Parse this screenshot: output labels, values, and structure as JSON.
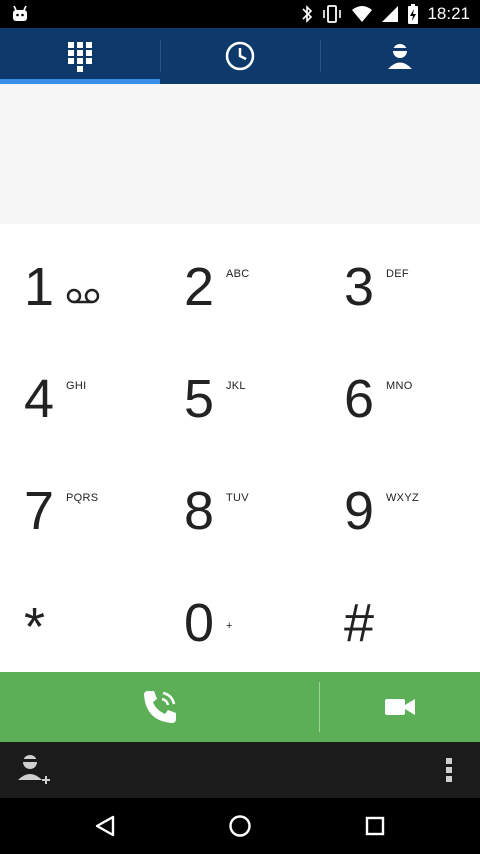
{
  "status_bar": {
    "time": "18:21",
    "icons": [
      "android-debug-icon",
      "bluetooth-icon",
      "vibrate-icon",
      "wifi-icon",
      "signal-icon",
      "battery-icon"
    ]
  },
  "tabs": [
    {
      "name": "dialpad",
      "icon": "dialpad-icon",
      "selected": true
    },
    {
      "name": "recents",
      "icon": "clock-icon",
      "selected": false
    },
    {
      "name": "contacts",
      "icon": "contact-icon",
      "selected": false
    }
  ],
  "keypad": {
    "keys": [
      {
        "digit": "1",
        "letters": "",
        "voicemail": true
      },
      {
        "digit": "2",
        "letters": "ABC"
      },
      {
        "digit": "3",
        "letters": "DEF"
      },
      {
        "digit": "4",
        "letters": "GHI"
      },
      {
        "digit": "5",
        "letters": "JKL"
      },
      {
        "digit": "6",
        "letters": "MNO"
      },
      {
        "digit": "7",
        "letters": "PQRS"
      },
      {
        "digit": "8",
        "letters": "TUV"
      },
      {
        "digit": "9",
        "letters": "WXYZ"
      },
      {
        "digit": "*",
        "letters": ""
      },
      {
        "digit": "0",
        "letters": "+"
      },
      {
        "digit": "#",
        "letters": ""
      }
    ]
  },
  "colors": {
    "tab_bar": "#0d3a6a",
    "tab_indicator": "#3b8ee8",
    "call_bar": "#5cae57",
    "bottom_bar": "#1b1b1b"
  }
}
